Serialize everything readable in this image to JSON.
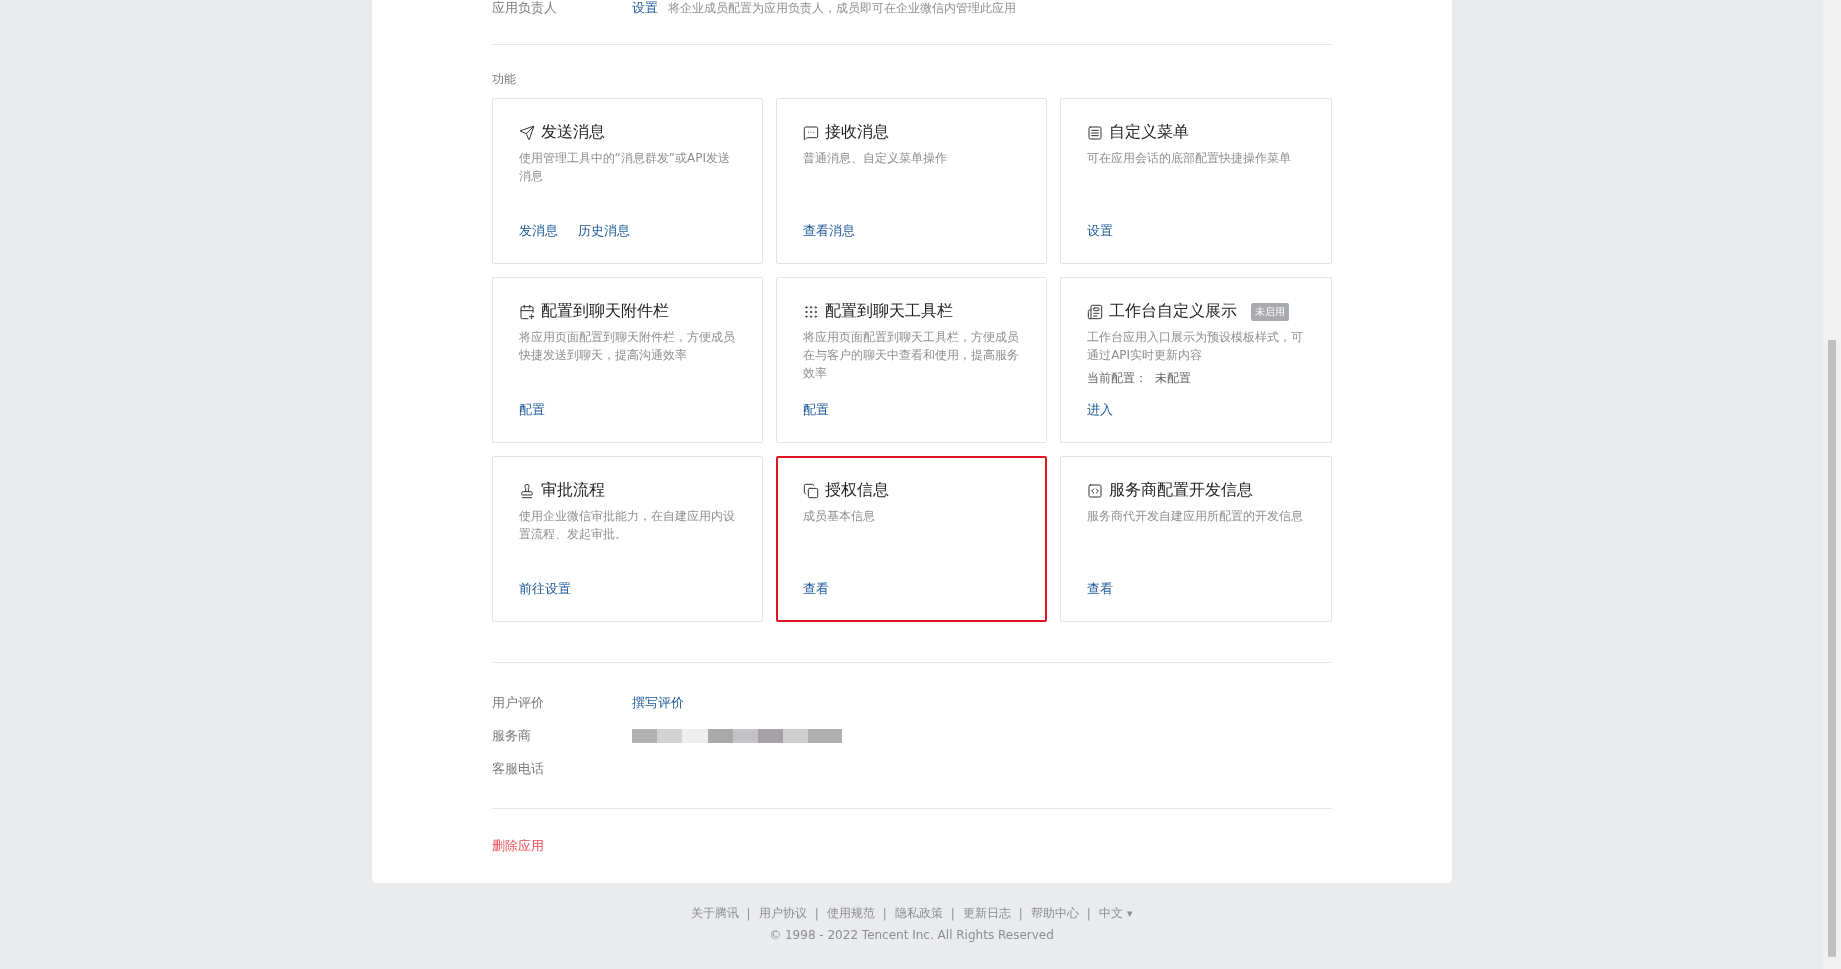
{
  "top_row": {
    "label": "应用负责人",
    "link": "设置",
    "description": "将企业成员配置为应用负责人，成员即可在企业微信内管理此应用"
  },
  "features": {
    "title": "功能",
    "cards": [
      {
        "title": "发送消息",
        "description": "使用管理工具中的“消息群发”或API发送消息",
        "links": [
          "发消息",
          "历史消息"
        ],
        "selected": false
      },
      {
        "title": "接收消息",
        "description": "普通消息、自定义菜单操作",
        "links": [
          "查看消息"
        ],
        "selected": false
      },
      {
        "title": "自定义菜单",
        "description": "可在应用会话的底部配置快捷操作菜单",
        "links": [
          "设置"
        ],
        "selected": false
      },
      {
        "title": "配置到聊天附件栏",
        "description": "将应用页面配置到聊天附件栏，方便成员快捷发送到聊天，提高沟通效率",
        "links": [
          "配置"
        ],
        "selected": false
      },
      {
        "title": "配置到聊天工具栏",
        "description": "将应用页面配置到聊天工具栏，方便成员在与客户的聊天中查看和使用，提高服务效率",
        "links": [
          "配置"
        ],
        "selected": false
      },
      {
        "title": "工作台自定义展示",
        "badge": "未启用",
        "description": "工作台应用入口展示为预设模板样式，可通过API实时更新内容",
        "config": {
          "label": "当前配置：",
          "value": "未配置"
        },
        "links": [
          "进入"
        ],
        "selected": false
      },
      {
        "title": "审批流程",
        "description": "使用企业微信审批能力，在自建应用内设置流程、发起审批。",
        "links": [
          "前往设置"
        ],
        "selected": false
      },
      {
        "title": "授权信息",
        "description": "成员基本信息",
        "links": [
          "查看"
        ],
        "selected": true
      },
      {
        "title": "服务商配置开发信息",
        "description": "服务商代开发自建应用所配置的开发信息",
        "links": [
          "查看"
        ],
        "selected": false
      }
    ]
  },
  "info_rows": [
    {
      "label": "用户评价",
      "link": "撰写评价"
    },
    {
      "label": "服务商",
      "redacted": true
    },
    {
      "label": "客服电话"
    }
  ],
  "delete_link": "删除应用",
  "footer": {
    "links": [
      "关于腾讯",
      "用户协议",
      "使用规范",
      "隐私政策",
      "更新日志",
      "帮助中心"
    ],
    "separator": "|",
    "language": "中文",
    "language_caret": "▾",
    "copyright": "© 1998 - 2022 Tencent Inc. All Rights Reserved"
  }
}
